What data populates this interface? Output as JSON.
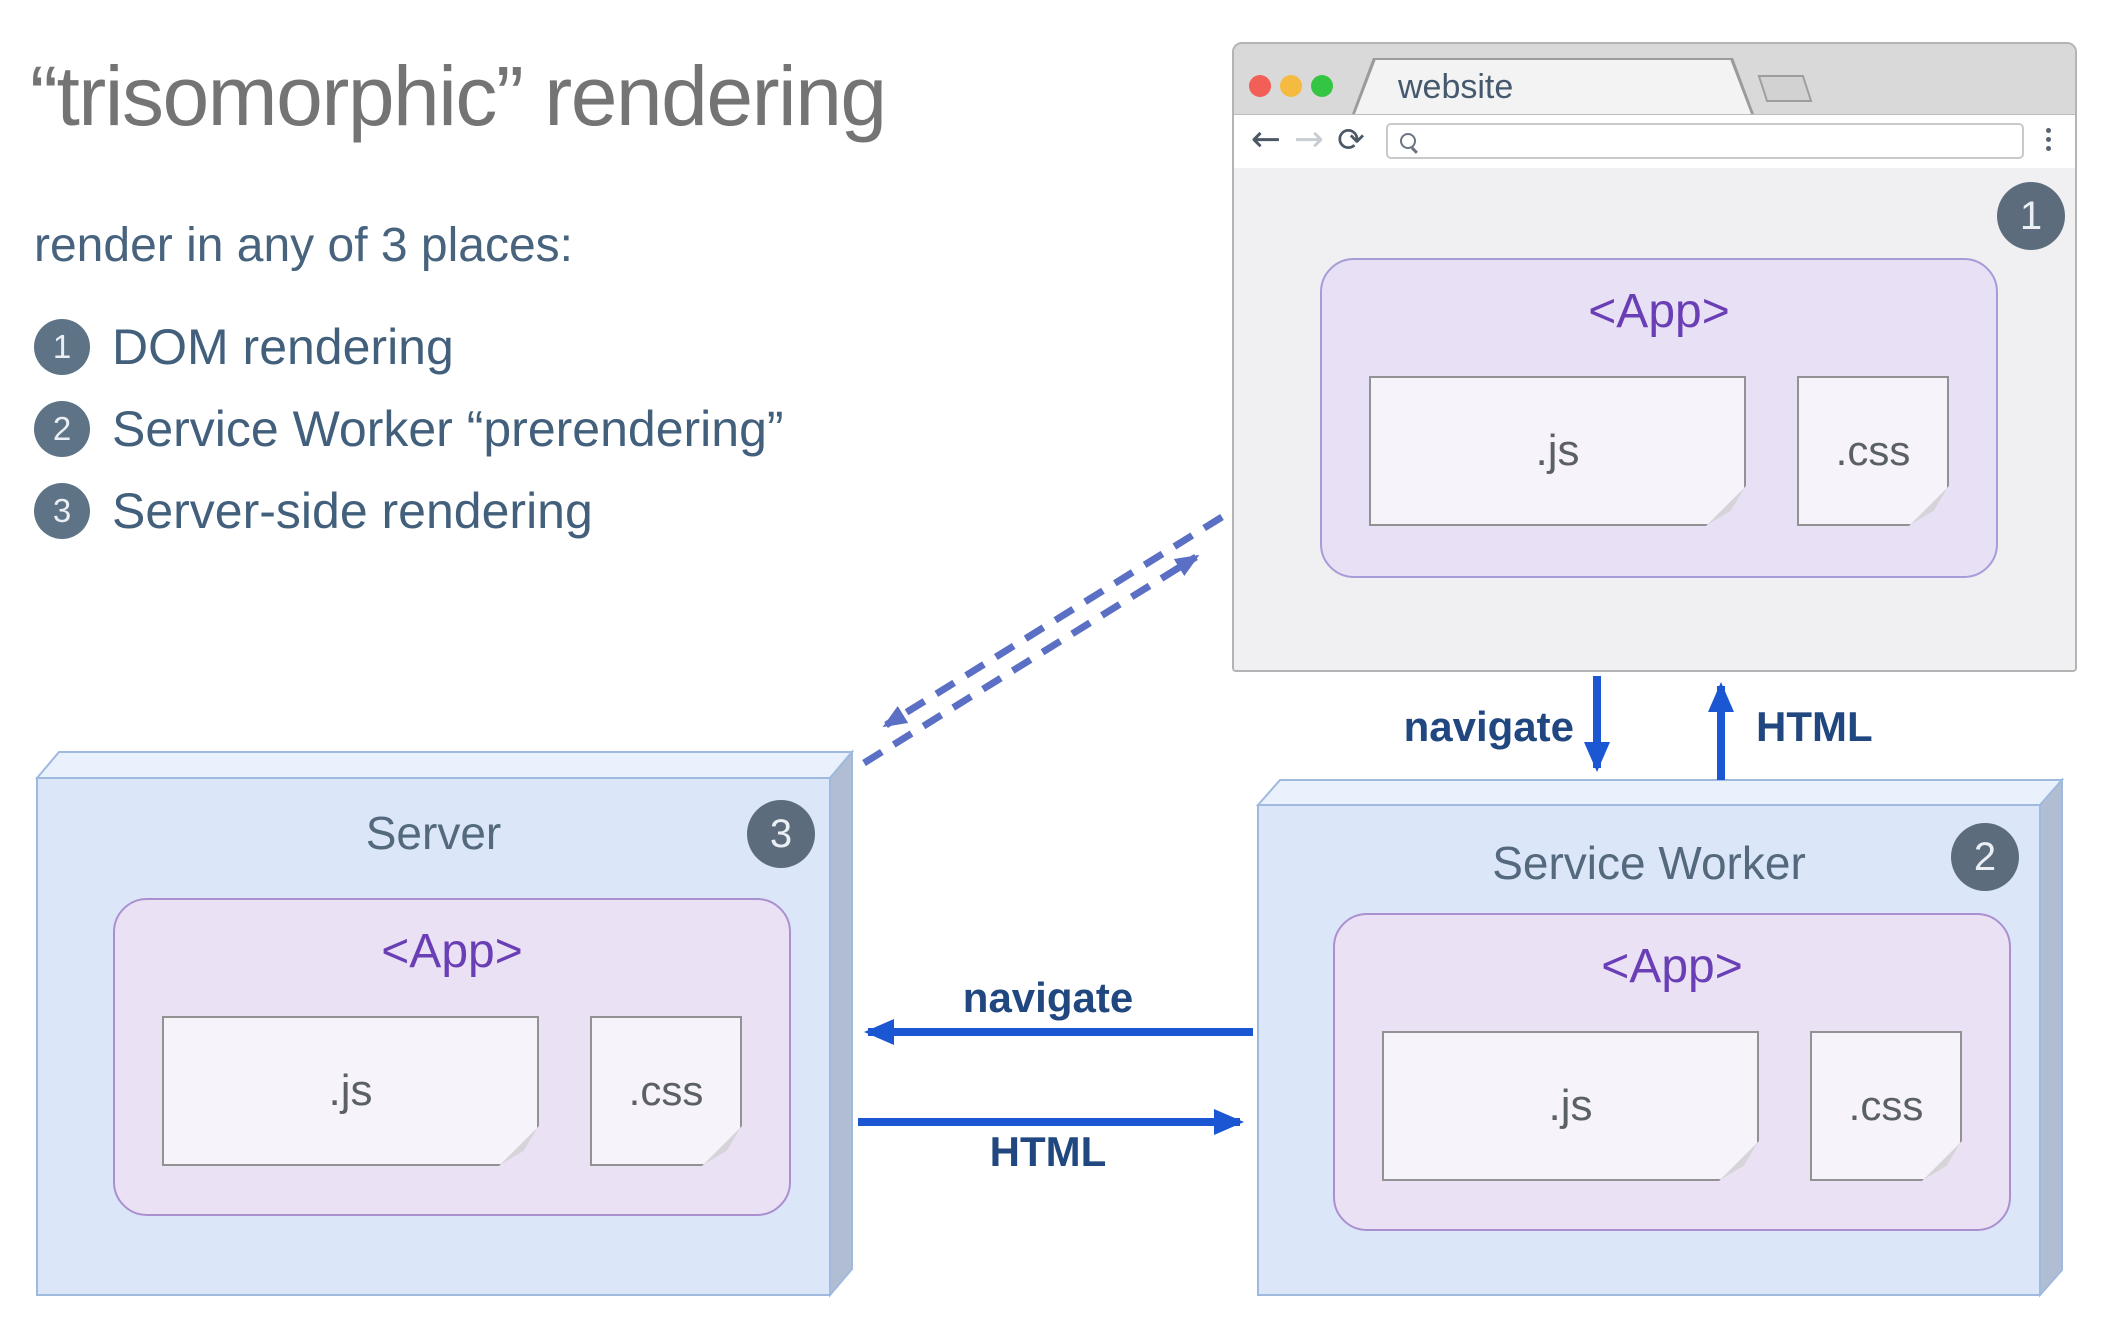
{
  "title": "“trisomorphic” rendering",
  "subtitle": "render in any of 3 places:",
  "legend": [
    {
      "num": "1",
      "label": "DOM rendering"
    },
    {
      "num": "2",
      "label": "Service Worker “prerendering”"
    },
    {
      "num": "3",
      "label": "Server-side rendering"
    }
  ],
  "browser": {
    "tab_title": "website",
    "badge": "1",
    "icons": {
      "back": "←",
      "forward": "→",
      "reload": "⟳"
    },
    "url_placeholder": "",
    "app": {
      "label": "<App>",
      "js": ".js",
      "css": ".css"
    }
  },
  "server": {
    "title": "Server",
    "badge": "3",
    "app": {
      "label": "<App>",
      "js": ".js",
      "css": ".css"
    }
  },
  "service_worker": {
    "title": "Service Worker",
    "badge": "2",
    "app": {
      "label": "<App>",
      "js": ".js",
      "css": ".css"
    }
  },
  "arrows": {
    "browser_to_sw": "navigate",
    "sw_to_browser": "HTML",
    "sw_to_server": "navigate",
    "server_to_sw": "HTML"
  },
  "colors": {
    "solid_arrow": "#1b57d3",
    "dashed_arrow": "#5b6fc4",
    "arrow_label": "#20477f",
    "app_purple": "#6a3fb5",
    "badge_slate": "#5d6c7c",
    "box_face_blue": "#dbe7f8",
    "app_lavender": "#e8e1f6",
    "title_gray": "#747474",
    "text_slate": "#42607c",
    "traffic_red": "#f15f56",
    "traffic_yellow": "#f4bb40",
    "traffic_green": "#34c642"
  }
}
